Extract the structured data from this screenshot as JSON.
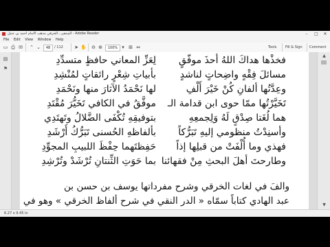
{
  "window": {
    "title": "المنتقى...الحرقي مذهب الامام احمد بن حنبل - Adobe Reader",
    "minimize": "–",
    "maximize": "□",
    "close": "✕"
  },
  "menu": [
    "File",
    "Edit",
    "View",
    "Window",
    "Help"
  ],
  "toolbar": {
    "page_current": "48",
    "page_total": "/ 112",
    "zoom": "100%",
    "tools": "Tools",
    "fill_sign": "Fill & Sign",
    "comment": "Comment"
  },
  "icons": {
    "open": "open-icon",
    "print": "print-icon",
    "email": "email-icon",
    "prev": "page-up-icon",
    "next": "page-down-icon",
    "zoom_out": "zoom-out-icon",
    "zoom_in": "zoom-in-icon"
  },
  "document": {
    "verses": [
      {
        "right": "فخذْها هداكَ اللهُ أحذَ موفّقٍ",
        "left": "لِعَزِّ المعاني حافظٍ متسدِّدِ"
      },
      {
        "right": "مسائلَ فِقْهٍ واضِحاتٍ لناشدٍ",
        "left": "بأبياتِ شِعْرٍ رائقاتٍ لمُنْشِدِ"
      },
      {
        "right": "وعِدَّتُها ألفانِ كُنْ خَيْرَ أَلْفِ",
        "left": "لها نَحْمَدُ الآثارَ منها ونَحْمَدِ"
      },
      {
        "right": "تَخَيَّرْتُها ممّا حوى ابن قدامة الـ",
        "left": "موفَّقُ في الكافي تَخَيُّرَ مُقْتَدِ"
      },
      {
        "right": "هما لُغَتا صِدْقٍ لَهُ وَلِجمعِهِ",
        "left": "بتوفيقِهِ تُكْفَى الضَّلالُ وتَهتَدِي"
      },
      {
        "right": "وأسنِدْتُ منظومي إليهِ تَبَرُّكاً",
        "left": "بألفاظهِ الحُسنى تَبَرُّكُ أَرْشَدِ"
      },
      {
        "right": "فهذي وما أُلْفَتْ من قبلِها إذاً",
        "left": "حَفِظتَهما حِفْظَ اللبيبِ المجوِّدِ"
      },
      {
        "right": "وطارحتَ أهلَ البحثِ مِنْ فقهائنا",
        "left": "بما حَوَتِ الثِّنتانِ تُرْشَدْ وتُرْشِدِ"
      }
    ],
    "prose": [
      "والفَ في لغات الخرقي وشرح مفرداتها يوسف بن حسن بن",
      "عبد الهادي كتاباً سمّاه « الدر النقي في شرح ألفاظ الخرقي » وهو في"
    ]
  },
  "status": {
    "page_size": "6.27 x 9.45 in"
  }
}
